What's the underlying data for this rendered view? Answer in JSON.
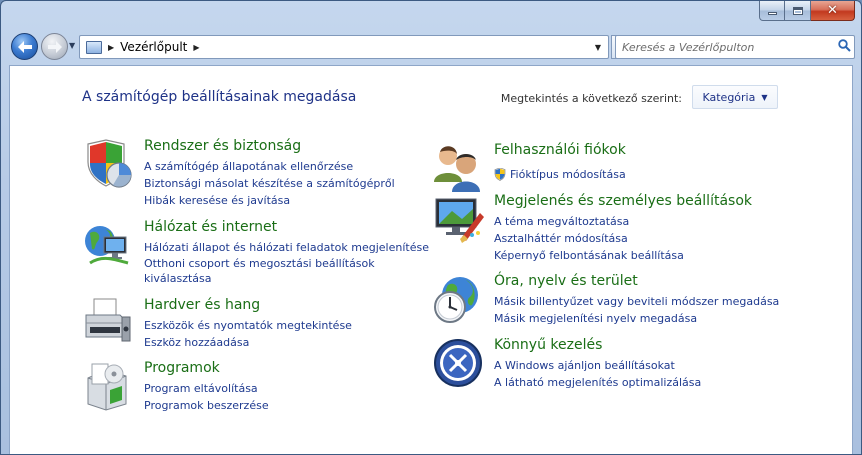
{
  "window": {
    "controls": {
      "minimize": "minimize",
      "maximize": "maximize",
      "close": "close"
    }
  },
  "nav": {
    "breadcrumb": [
      "Vezérlőpult"
    ],
    "search_placeholder": "Keresés a Vezérlőpulton"
  },
  "header": {
    "title": "A számítógép beállításainak megadása",
    "view_by_label": "Megtekintés a következő szerint:",
    "view_by_value": "Kategória"
  },
  "left_categories": [
    {
      "title": "Rendszer és biztonság",
      "icon": "shield-chart-icon",
      "links": [
        "A számítógép állapotának ellenőrzése",
        "Biztonsági másolat készítése a számítógépről",
        "Hibák keresése és javítása"
      ]
    },
    {
      "title": "Hálózat és internet",
      "icon": "network-globe-icon",
      "links": [
        "Hálózati állapot és hálózati feladatok megjelenítése",
        "Otthoni csoport és megosztási beállítások kiválasztása"
      ]
    },
    {
      "title": "Hardver és hang",
      "icon": "printer-icon",
      "links": [
        "Eszközök és nyomtatók megtekintése",
        "Eszköz hozzáadása"
      ]
    },
    {
      "title": "Programok",
      "icon": "programs-box-icon",
      "links": [
        "Program eltávolítása",
        "Programok beszerzése"
      ]
    }
  ],
  "right_categories": [
    {
      "title": "Felhasználói fiókok",
      "icon": "users-icon",
      "links": [
        "Fióktípus módosítása"
      ]
    },
    {
      "title": "Megjelenés és személyes beállítások",
      "icon": "monitor-paint-icon",
      "links": [
        "A téma megváltoztatása",
        "Asztalháttér módosítása",
        "Képernyő felbontásának beállítása"
      ]
    },
    {
      "title": "Óra, nyelv és terület",
      "icon": "clock-globe-icon",
      "links": [
        "Másik billentyűzet vagy beviteli módszer megadása",
        "Másik megjelenítési nyelv megadása"
      ]
    },
    {
      "title": "Könnyű kezelés",
      "icon": "ease-of-access-icon",
      "links": [
        "A Windows ajánljon beállításokat",
        "A látható megjelenítés optimalizálása"
      ]
    }
  ]
}
